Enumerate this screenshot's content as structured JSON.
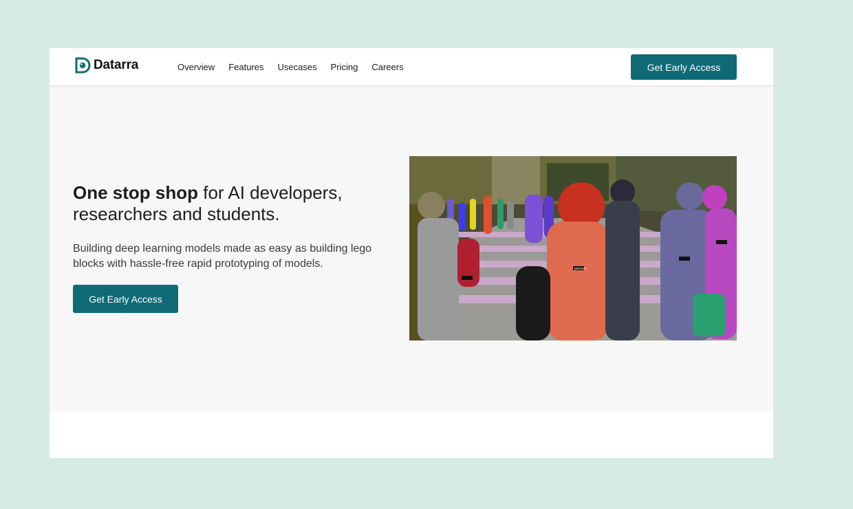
{
  "brand": {
    "name": "Datarra",
    "color": "#0f6a76"
  },
  "nav": {
    "items": [
      "Overview",
      "Features",
      "Usecases",
      "Pricing",
      "Careers"
    ],
    "cta_label": "Get Early Access"
  },
  "hero": {
    "headline_bold": "One stop shop",
    "headline_rest": " for AI developers, researchers and students.",
    "subtext": "Building deep learning models made as easy as building lego blocks with hassle-free rapid prototyping of models.",
    "cta_label": "Get Early Access",
    "image_label": "segmented crowd crossing street",
    "image_tag": "person"
  },
  "colors": {
    "page_bg": "#d7ebe5",
    "hero_bg": "#f7f7f7",
    "button_bg": "#0f6a76"
  }
}
